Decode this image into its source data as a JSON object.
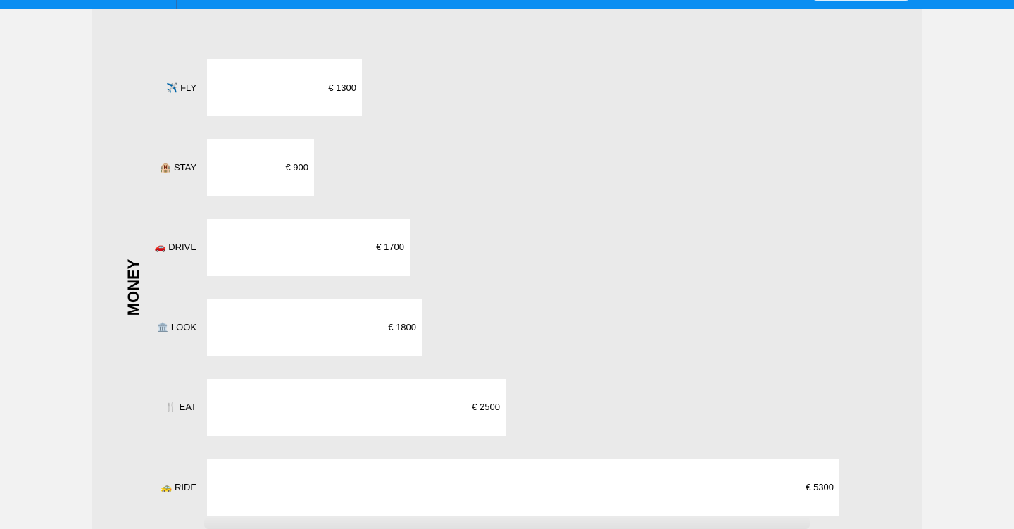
{
  "chart_data": {
    "type": "bar",
    "orientation": "horizontal",
    "ylabel": "MONEY",
    "currency_prefix": "€ ",
    "categories": [
      {
        "icon": "✈️",
        "label": "FLY"
      },
      {
        "icon": "🏨",
        "label": "STAY"
      },
      {
        "icon": "🚗",
        "label": "DRIVE"
      },
      {
        "icon": "🏛️",
        "label": "LOOK"
      },
      {
        "icon": "🍴",
        "label": "EAT"
      },
      {
        "icon": "🚕",
        "label": "RIDE"
      }
    ],
    "values": [
      1300,
      900,
      1700,
      1800,
      2500,
      5300
    ],
    "value_labels": [
      "€ 1300",
      "€ 900",
      "€ 1700",
      "€ 1800",
      "€ 2500",
      "€ 5300"
    ],
    "xlim": [
      0,
      5300
    ],
    "grid": false
  },
  "colors": {
    "header": "#0a8ef2",
    "panel": "#eaeaea",
    "bar": "#ffffff",
    "page": "#f2f2f2"
  }
}
